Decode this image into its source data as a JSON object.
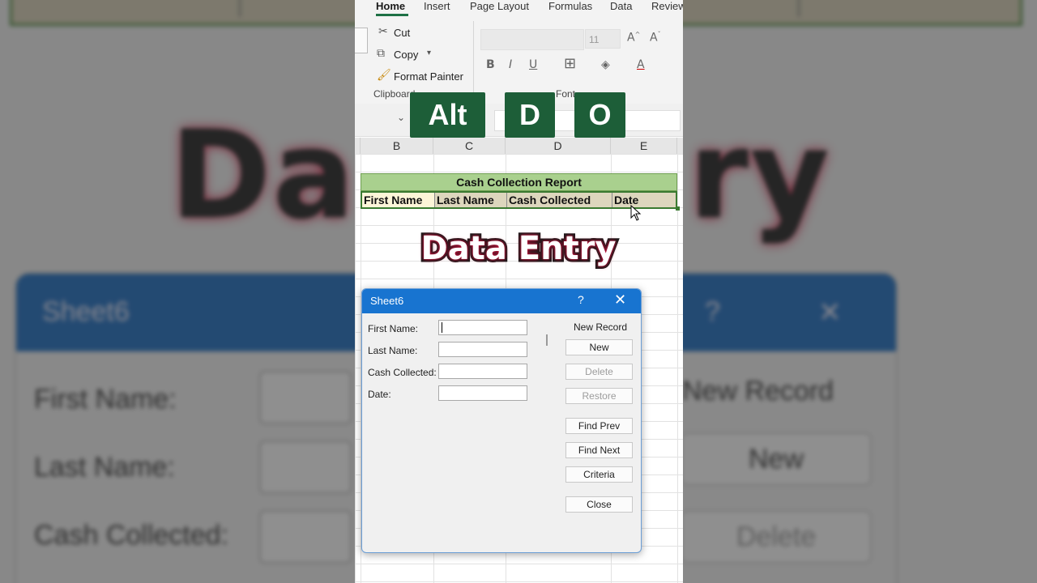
{
  "ribbon": {
    "tabs": [
      "Home",
      "Insert",
      "Page Layout",
      "Formulas",
      "Data",
      "Review"
    ],
    "clipboard": {
      "cut": "Cut",
      "copy": "Copy",
      "format_painter": "Format Painter",
      "group_label": "Clipboard"
    },
    "font": {
      "size": "11",
      "group_label": "Font"
    }
  },
  "keys": [
    "Alt",
    "D",
    "O"
  ],
  "sheet": {
    "columns": [
      "B",
      "C",
      "D",
      "E"
    ],
    "report_title": "Cash Collection Report",
    "headers": [
      "First Name",
      "Last Name",
      "Cash Collected",
      "Date"
    ]
  },
  "caption": "Data Entry",
  "dialog": {
    "title": "Sheet6",
    "help": "?",
    "close_glyph": "✕",
    "fields": [
      {
        "label": "First Name:",
        "value": ""
      },
      {
        "label": "Last Name:",
        "value": ""
      },
      {
        "label": "Cash Collected:",
        "value": ""
      },
      {
        "label": "Date:",
        "value": ""
      }
    ],
    "record_status": "New Record",
    "buttons": [
      {
        "label": "New",
        "enabled": true
      },
      {
        "label": "Delete",
        "enabled": false
      },
      {
        "label": "Restore",
        "enabled": false
      },
      {
        "label": "Find Prev",
        "enabled": true
      },
      {
        "label": "Find Next",
        "enabled": true
      },
      {
        "label": "Criteria",
        "enabled": true
      },
      {
        "label": "Close",
        "enabled": true
      }
    ]
  },
  "colors": {
    "key_bg": "#1d5e38",
    "title_fill": "#a9d08e",
    "dialog_titlebar": "#1874d0",
    "header_border": "#3a7a30"
  }
}
